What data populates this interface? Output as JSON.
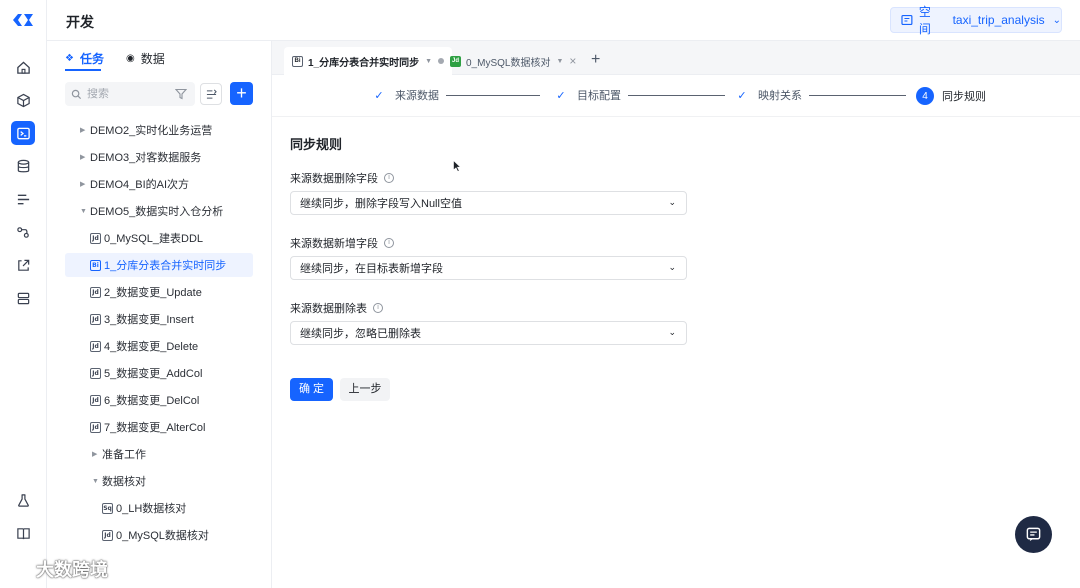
{
  "header": {
    "title": "开发",
    "space_label": "空间",
    "space_value": "taxi_trip_analysis"
  },
  "sidebar": {
    "tabs": [
      {
        "label": "任务"
      },
      {
        "label": "数据"
      }
    ],
    "search_placeholder": "搜索",
    "add_label": "+",
    "tree": [
      {
        "label": "DEMO2_实时化业务运营"
      },
      {
        "label": "DEMO3_对客数据服务"
      },
      {
        "label": "DEMO4_BI的AI次方"
      },
      {
        "label": "DEMO5_数据实时入仓分析"
      },
      {
        "label": "0_MySQL_建表DDL",
        "icon": "Jd"
      },
      {
        "label": "1_分库分表合并实时同步",
        "icon": "Bi"
      },
      {
        "label": "2_数据变更_Update",
        "icon": "Jd"
      },
      {
        "label": "3_数据变更_Insert",
        "icon": "Jd"
      },
      {
        "label": "4_数据变更_Delete",
        "icon": "Jd"
      },
      {
        "label": "5_数据变更_AddCol",
        "icon": "Jd"
      },
      {
        "label": "6_数据变更_DelCol",
        "icon": "Jd"
      },
      {
        "label": "7_数据变更_AlterCol",
        "icon": "Jd"
      },
      {
        "label": "准备工作"
      },
      {
        "label": "数据核对"
      },
      {
        "label": "0_LH数据核对",
        "icon": "Sq"
      },
      {
        "label": "0_MySQL数据核对",
        "icon": "Jd"
      }
    ]
  },
  "editor_tabs": [
    {
      "label": "1_分库分表合并实时同步",
      "icon": "Bi"
    },
    {
      "label": "0_MySQL数据核对",
      "icon": "Jd"
    }
  ],
  "tab_add_label": "+",
  "stepper": {
    "steps": [
      {
        "label": "来源数据"
      },
      {
        "label": "目标配置"
      },
      {
        "label": "映射关系"
      },
      {
        "label": "同步规则",
        "number": "4"
      }
    ],
    "current_index": 3
  },
  "form": {
    "title": "同步规则",
    "fields": [
      {
        "label": "来源数据删除字段",
        "value": "继续同步，删除字段写入Null空值"
      },
      {
        "label": "来源数据新增字段",
        "value": "继续同步，在目标表新增字段"
      },
      {
        "label": "来源数据删除表",
        "value": "继续同步，忽略已删除表"
      }
    ],
    "confirm_label": "确 定",
    "prev_label": "上一步"
  },
  "watermark": {
    "text": "大数跨境"
  },
  "colors": {
    "accent": "#1664ff",
    "fab": "#1f2a44"
  }
}
